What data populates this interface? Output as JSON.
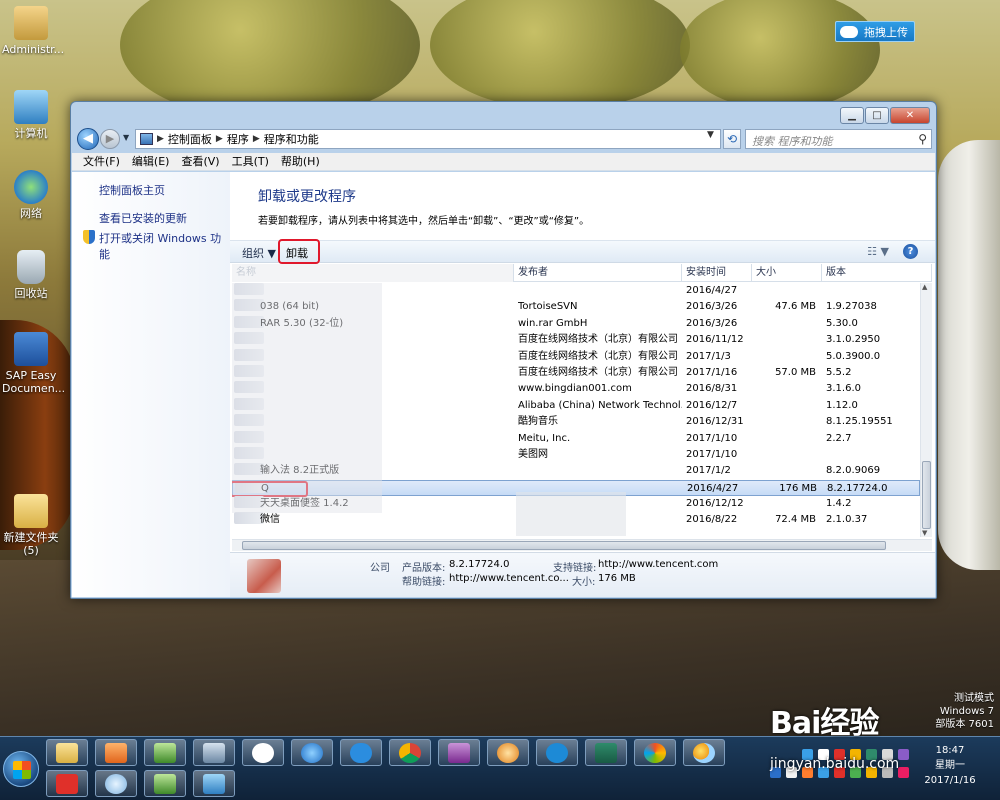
{
  "desktop": {
    "icons": [
      {
        "label": "Administr..."
      },
      {
        "label": "计算机"
      },
      {
        "label": "网络"
      },
      {
        "label": "回收站"
      },
      {
        "label": "SAP Easy Documen..."
      },
      {
        "label": "新建文件夹 (5)"
      }
    ],
    "upload_button": "拖拽上传"
  },
  "window": {
    "controls": {
      "minimize": "▁",
      "maximize": "□",
      "close": "✕"
    },
    "breadcrumb": [
      "控制面板",
      "程序",
      "程序和功能"
    ],
    "search_placeholder": "搜索 程序和功能",
    "menu": [
      "文件(F)",
      "编辑(E)",
      "查看(V)",
      "工具(T)",
      "帮助(H)"
    ],
    "sidebar": {
      "home": "控制面板主页",
      "updates": "查看已安装的更新",
      "features": "打开或关闭 Windows 功能"
    },
    "title": "卸载或更改程序",
    "description": "若要卸载程序，请从列表中将其选中，然后单击“卸载”、“更改”或“修复”。",
    "toolbar": {
      "organize": "组织 ▼",
      "uninstall": "卸载",
      "view": "☷ ▼",
      "help": "?"
    },
    "columns": {
      "name": "名称",
      "publisher": "发布者",
      "date": "安装时间",
      "size": "大小",
      "version": "版本"
    },
    "programs": [
      {
        "name": "",
        "publisher": "",
        "date": "2016/4/27",
        "size": "",
        "version": ""
      },
      {
        "name": "038 (64 bit)",
        "publisher": "TortoiseSVN",
        "date": "2016/3/26",
        "size": "47.6 MB",
        "version": "1.9.27038"
      },
      {
        "name": "RAR 5.30 (32-位)",
        "publisher": "win.rar GmbH",
        "date": "2016/3/26",
        "size": "",
        "version": "5.30.0"
      },
      {
        "name": "",
        "publisher": "百度在线网络技术（北京）有限公司",
        "date": "2016/11/12",
        "size": "",
        "version": "3.1.0.2950"
      },
      {
        "name": "",
        "publisher": "百度在线网络技术（北京）有限公司",
        "date": "2017/1/3",
        "size": "",
        "version": "5.0.3900.0"
      },
      {
        "name": "",
        "publisher": "百度在线网络技术（北京）有限公司",
        "date": "2017/1/16",
        "size": "57.0 MB",
        "version": "5.5.2"
      },
      {
        "name": "",
        "publisher": "www.bingdian001.com",
        "date": "2016/8/31",
        "size": "",
        "version": "3.1.6.0"
      },
      {
        "name": "",
        "publisher": "Alibaba (China) Network Technol...",
        "date": "2016/12/7",
        "size": "",
        "version": "1.12.0"
      },
      {
        "name": "",
        "publisher": "酷狗音乐",
        "date": "2016/12/31",
        "size": "",
        "version": "8.1.25.19551"
      },
      {
        "name": "",
        "publisher": "Meitu, Inc.",
        "date": "2017/1/10",
        "size": "",
        "version": "2.2.7"
      },
      {
        "name": "",
        "publisher": "美图网",
        "date": "2017/1/10",
        "size": "",
        "version": ""
      },
      {
        "name": "输入法 8.2正式版",
        "publisher": "",
        "date": "2017/1/2",
        "size": "",
        "version": "8.2.0.9069"
      },
      {
        "name": "Q",
        "publisher": "",
        "date": "2016/4/27",
        "size": "176 MB",
        "version": "8.2.17724.0"
      },
      {
        "name": "天天桌面便签 1.4.2",
        "publisher": "",
        "date": "2016/12/12",
        "size": "",
        "version": "1.4.2"
      },
      {
        "name": "微信",
        "publisher": "",
        "date": "2016/8/22",
        "size": "72.4 MB",
        "version": "2.1.0.37"
      }
    ],
    "selected_index": 12,
    "details": {
      "publisher_suffix": "公司",
      "product_version_label": "产品版本:",
      "product_version": "8.2.17724.0",
      "support_link_label": "支持链接:",
      "support_link": "http://www.tencent.com",
      "help_link_label": "帮助链接:",
      "help_link": "http://www.tencent.co...",
      "size_label": "大小:",
      "size": "176 MB"
    }
  },
  "system": {
    "watermark_1": "测试模式",
    "watermark_2": "Windows 7",
    "watermark_3": "部版本 7601",
    "time": "18:47",
    "weekday": "星期一",
    "date": "2017/1/16"
  },
  "overlay": {
    "logo": "Bai经验",
    "url": "jingyan.baidu.com"
  }
}
